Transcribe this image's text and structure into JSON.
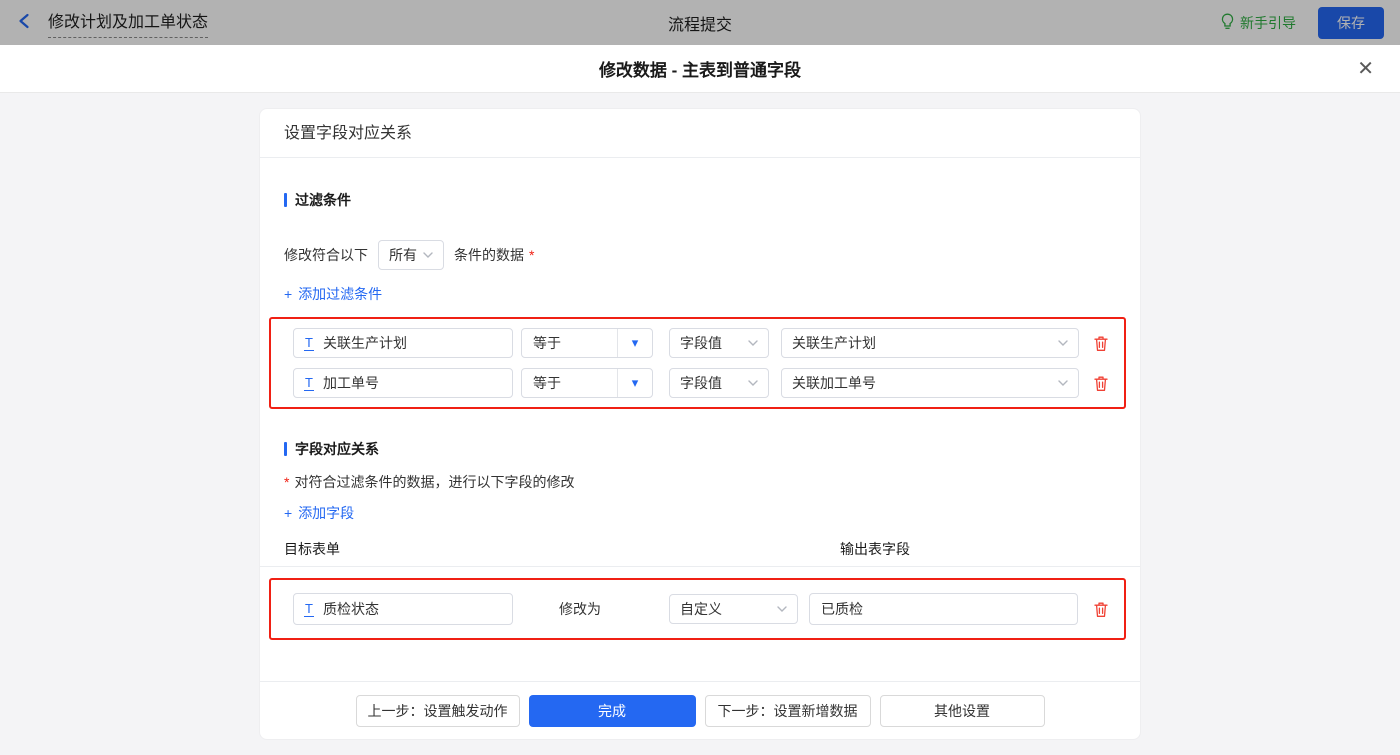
{
  "colors": {
    "accent_blue": "#2468f2",
    "highlight_red": "#f02014",
    "danger_red": "#f04134",
    "guide_green": "#2eae42",
    "body_gray": "#f4f4f6"
  },
  "icons": {
    "plus": "+",
    "caret_down_filled": "▾",
    "close": "✕",
    "text_field": "T"
  },
  "topbar": {
    "back_title": "修改计划及加工单状态",
    "center_title": "流程提交",
    "guide_label": "新手引导",
    "save_label": "保存"
  },
  "dialog": {
    "title": "修改数据 - 主表到普通字段"
  },
  "card": {
    "header": "设置字段对应关系",
    "filter_section": {
      "title": "过滤条件",
      "prefix": "修改符合以下",
      "match_select_value": "所有",
      "suffix": "条件的数据",
      "required_mark": "*",
      "add_link": "添加过滤条件",
      "rows": [
        {
          "field": "关联生产计划",
          "operator": "等于",
          "value_type": "字段值",
          "value": "关联生产计划"
        },
        {
          "field": "加工单号",
          "operator": "等于",
          "value_type": "字段值",
          "value": "关联加工单号"
        }
      ]
    },
    "mapping_section": {
      "title": "字段对应关系",
      "required_mark": "*",
      "note": "对符合过滤条件的数据，进行以下字段的修改",
      "add_link": "添加字段",
      "col_target": "目标表单",
      "col_output": "输出表字段",
      "rows": [
        {
          "field": "质检状态",
          "middle_label": "修改为",
          "mode": "自定义",
          "value": "已质检"
        }
      ]
    },
    "footer": {
      "prev_label": "上一步：设置触发动作",
      "done_label": "完成",
      "next_label": "下一步：设置新增数据",
      "other_label": "其他设置"
    }
  }
}
